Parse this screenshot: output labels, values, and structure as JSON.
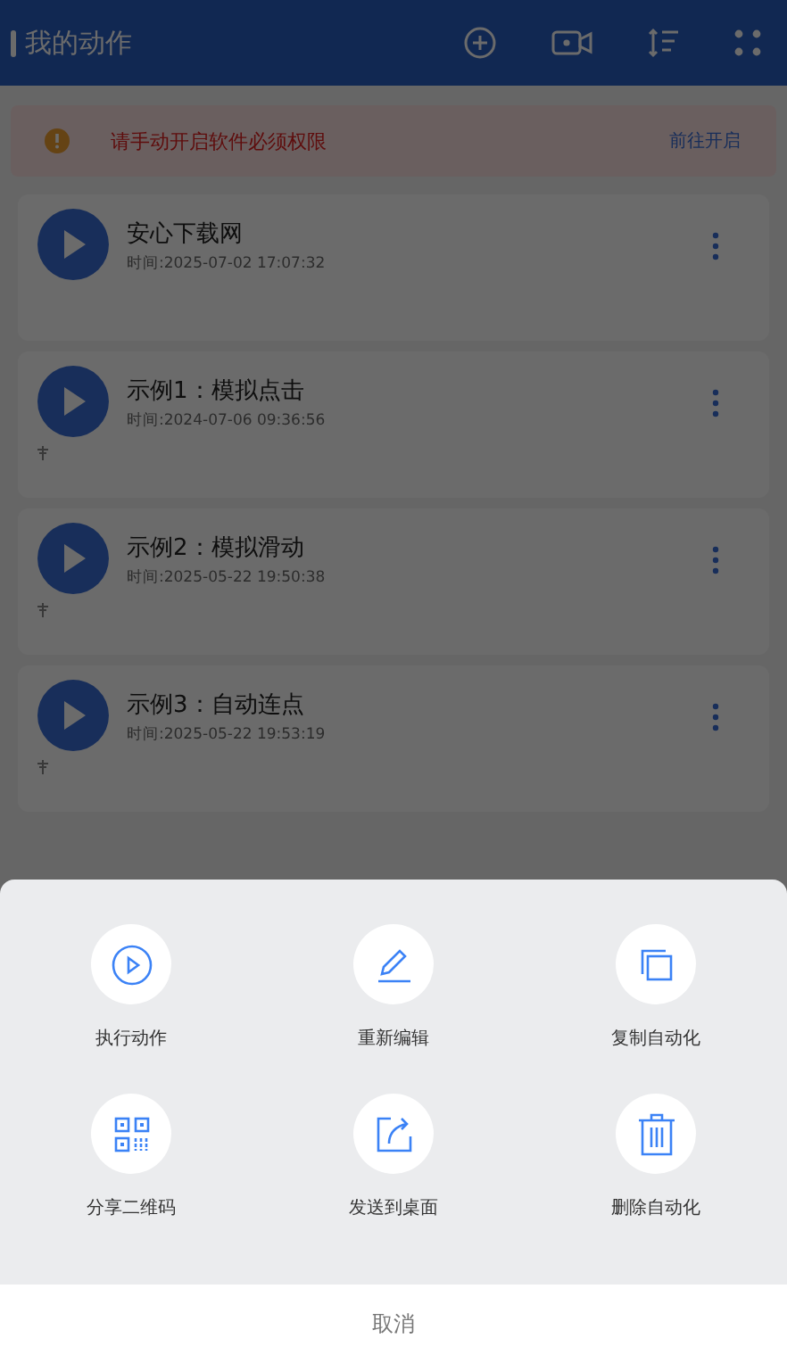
{
  "app_bar": {
    "title": "我的动作"
  },
  "banner": {
    "message": "请手动开启软件必须权限",
    "action": "前往开启"
  },
  "actions": [
    {
      "title": "安心下载网",
      "time": "时间:2025-07-02 17:07:32",
      "pinned": false
    },
    {
      "title": "示例1：模拟点击",
      "time": "时间:2024-07-06 09:36:56",
      "pinned": true
    },
    {
      "title": "示例2：模拟滑动",
      "time": "时间:2025-05-22 19:50:38",
      "pinned": true
    },
    {
      "title": "示例3：自动连点",
      "time": "时间:2025-05-22 19:53:19",
      "pinned": true
    }
  ],
  "sheet": {
    "options": [
      {
        "kind": "run",
        "label": "执行动作"
      },
      {
        "kind": "edit",
        "label": "重新编辑"
      },
      {
        "kind": "copy",
        "label": "复制自动化"
      },
      {
        "kind": "qr",
        "label": "分享二维码"
      },
      {
        "kind": "send",
        "label": "发送到桌面"
      },
      {
        "kind": "delete",
        "label": "删除自动化"
      }
    ],
    "cancel": "取消"
  }
}
